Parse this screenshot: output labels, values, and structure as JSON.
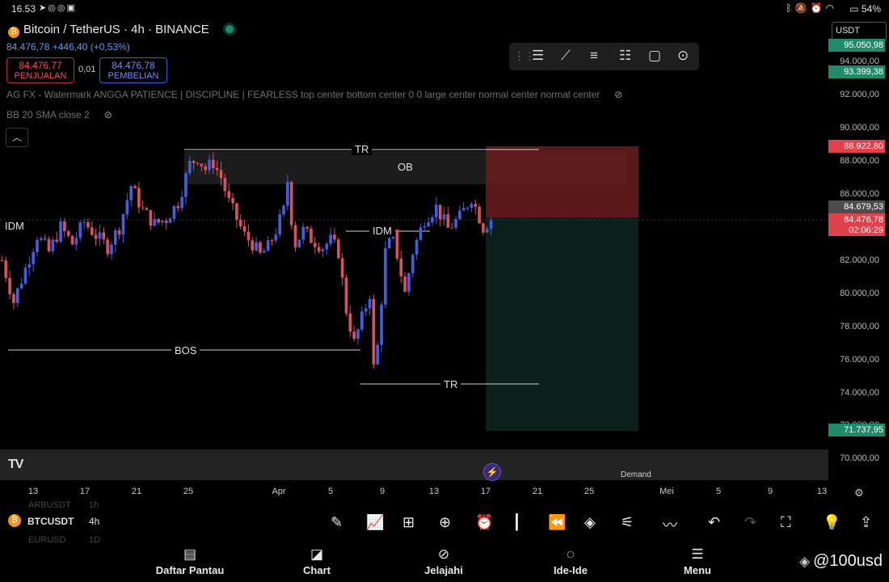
{
  "status_bar": {
    "time": "16.53",
    "left_icons": [
      "telegram-icon",
      "whatsapp-icon",
      "whatsapp-icon",
      "instagram-icon"
    ],
    "right_icons": [
      "bluetooth-icon",
      "mute-icon",
      "alarm-icon",
      "wifi-icon"
    ],
    "battery": "54%"
  },
  "header": {
    "title": "Bitcoin / TetherUS · 4h · BINANCE",
    "coin_glyph": "₿",
    "price": "84.476,78",
    "change": "+446,40 (+0,53%)",
    "sell_value": "84.476,77",
    "sell_label": "PENJUALAN",
    "spread": "0,01",
    "buy_value": "84.476,78",
    "buy_label": "PEMBELIAN"
  },
  "indicators": {
    "line1": "AG FX - Watermark ANGGA PATIENCE | DISCIPLINE | FEARLESS top center bottom center 0 0 large center normal center normal center",
    "line2": "BB 20 SMA close 2"
  },
  "currency_select": "USDT",
  "price_axis": {
    "ticks": [
      "94.000,00",
      "92.000,00",
      "90.000,00",
      "88.000,00",
      "86.000,00",
      "82.000,00",
      "80.000,00",
      "78.000,00",
      "76.000,00",
      "74.000,00",
      "72.000,00",
      "70.000,00"
    ],
    "tags": {
      "top": "95.050,98",
      "target": "93.399,38",
      "stop": "88.922,80",
      "level": "84.679,53",
      "current": "84.476,78",
      "countdown": "02:06:29",
      "bottom": "71.737,95"
    },
    "colors": {
      "green": "#1e8c6a",
      "red": "#e0414b",
      "grey": "#4d4d4d"
    }
  },
  "chart_labels": {
    "tr_top": "TR",
    "ob": "OB",
    "idm_left": "IDM",
    "idm_mid": "IDM",
    "bos": "BOS",
    "tr_bottom": "TR",
    "demand": "Demand"
  },
  "time_axis": [
    "13",
    "17",
    "21",
    "25",
    "Apr",
    "5",
    "9",
    "13",
    "17",
    "21",
    "25",
    "Mei",
    "5",
    "9",
    "13"
  ],
  "bottom_toolbar": {
    "symbol": "BTCUSDT",
    "interval": "4h",
    "ghost_above": "ARBUSDT",
    "ghost_above_interval": "1h",
    "ghost_below": "EURUSD",
    "ghost_below_interval": "1D"
  },
  "nav": {
    "watchlist": "Daftar Pantau",
    "chart": "Chart",
    "explore": "Jelajahi",
    "ideas": "Ide-Ide",
    "menu": "Menu"
  },
  "watermark": "@100usd",
  "chart_data": {
    "type": "candlestick",
    "symbol": "Bitcoin / TetherUS",
    "interval": "4h",
    "ylim": [
      70000,
      95000
    ],
    "close_path": [
      [
        0,
        82000
      ],
      [
        3,
        79500
      ],
      [
        6,
        81500
      ],
      [
        9,
        83500
      ],
      [
        12,
        82500
      ],
      [
        15,
        84000
      ],
      [
        18,
        83000
      ],
      [
        21,
        84300
      ],
      [
        24,
        83500
      ],
      [
        27,
        82800
      ],
      [
        30,
        84000
      ],
      [
        33,
        86500
      ],
      [
        36,
        85000
      ],
      [
        39,
        84200
      ],
      [
        42,
        84500
      ],
      [
        45,
        85500
      ],
      [
        48,
        87800
      ],
      [
        50,
        88200
      ],
      [
        52,
        87500
      ],
      [
        54,
        87900
      ],
      [
        56,
        87000
      ],
      [
        58,
        85500
      ],
      [
        60,
        84500
      ],
      [
        62,
        83500
      ],
      [
        64,
        83000
      ],
      [
        66,
        82300
      ],
      [
        68,
        82800
      ],
      [
        70,
        83800
      ],
      [
        72,
        85000
      ],
      [
        73,
        86800
      ],
      [
        74,
        84500
      ],
      [
        75,
        83000
      ],
      [
        77,
        83800
      ],
      [
        79,
        83300
      ],
      [
        82,
        82800
      ],
      [
        84,
        83200
      ],
      [
        86,
        82500
      ],
      [
        88,
        79000
      ],
      [
        90,
        77000
      ],
      [
        92,
        78500
      ],
      [
        94,
        80000
      ],
      [
        95,
        75500
      ],
      [
        96,
        76800
      ],
      [
        98,
        82500
      ],
      [
        100,
        83500
      ],
      [
        103,
        80000
      ],
      [
        105,
        82500
      ],
      [
        108,
        84500
      ],
      [
        111,
        85200
      ],
      [
        114,
        83900
      ],
      [
        117,
        84600
      ],
      [
        120,
        85800
      ],
      [
        123,
        84000
      ],
      [
        125,
        84500
      ]
    ]
  }
}
